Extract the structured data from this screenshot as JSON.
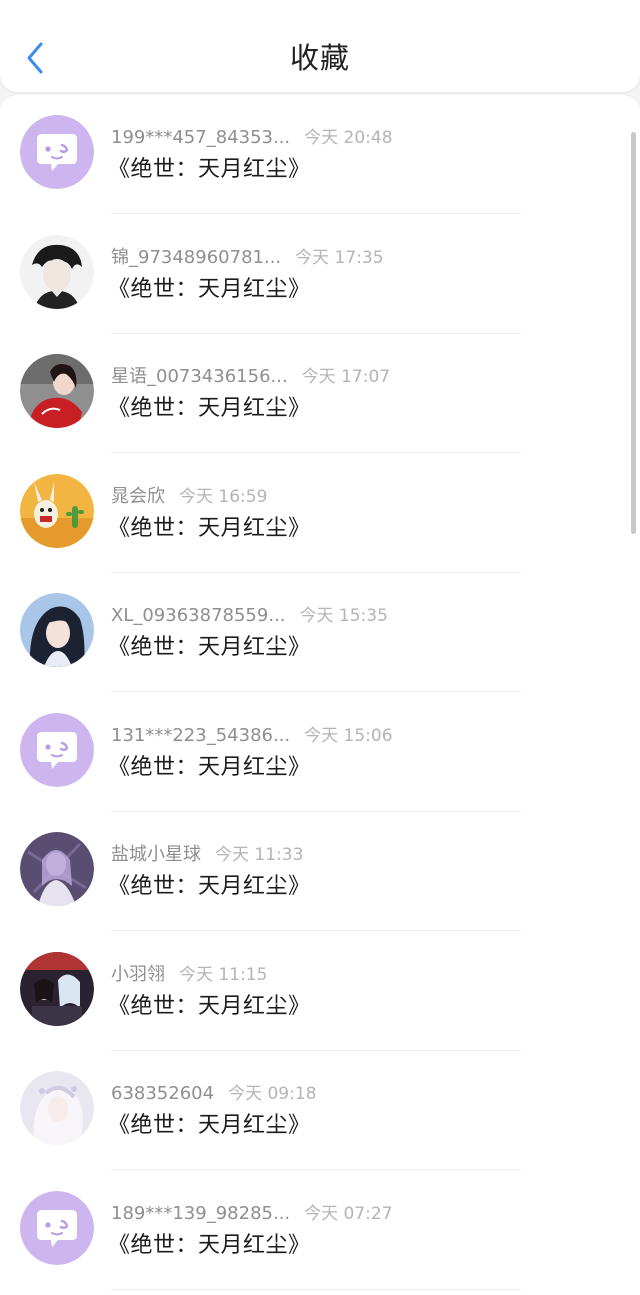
{
  "header": {
    "title": "收藏",
    "back_icon": "chevron-left-icon",
    "accent": "#3b8cf0"
  },
  "items": [
    {
      "name": "199***457_84353...",
      "time": "今天 20:48",
      "content": "《绝世：天月红尘》",
      "avatar": "default"
    },
    {
      "name": "锦_97348960781...",
      "time": "今天 17:35",
      "content": "《绝世：天月红尘》",
      "avatar": "photo-dark-hair"
    },
    {
      "name": "星语_0073436156...",
      "time": "今天 17:07",
      "content": "《绝世：天月红尘》",
      "avatar": "photo-red-dress"
    },
    {
      "name": "晁会欣",
      "time": "今天 16:59",
      "content": "《绝世：天月红尘》",
      "avatar": "cartoon-desert"
    },
    {
      "name": "XL_09363878559...",
      "time": "今天 15:35",
      "content": "《绝世：天月红尘》",
      "avatar": "anime-girl"
    },
    {
      "name": "131***223_54386...",
      "time": "今天 15:06",
      "content": "《绝世：天月红尘》",
      "avatar": "default"
    },
    {
      "name": "盐城小星球",
      "time": "今天 11:33",
      "content": "《绝世：天月红尘》",
      "avatar": "anime-purple"
    },
    {
      "name": "小羽翎",
      "time": "今天 11:15",
      "content": "《绝世：天月红尘》",
      "avatar": "anime-group"
    },
    {
      "name": "638352604",
      "time": "今天 09:18",
      "content": "《绝世：天月红尘》",
      "avatar": "anime-white"
    },
    {
      "name": "189***139_98285...",
      "time": "今天 07:27",
      "content": "《绝世：天月红尘》",
      "avatar": "default"
    }
  ]
}
